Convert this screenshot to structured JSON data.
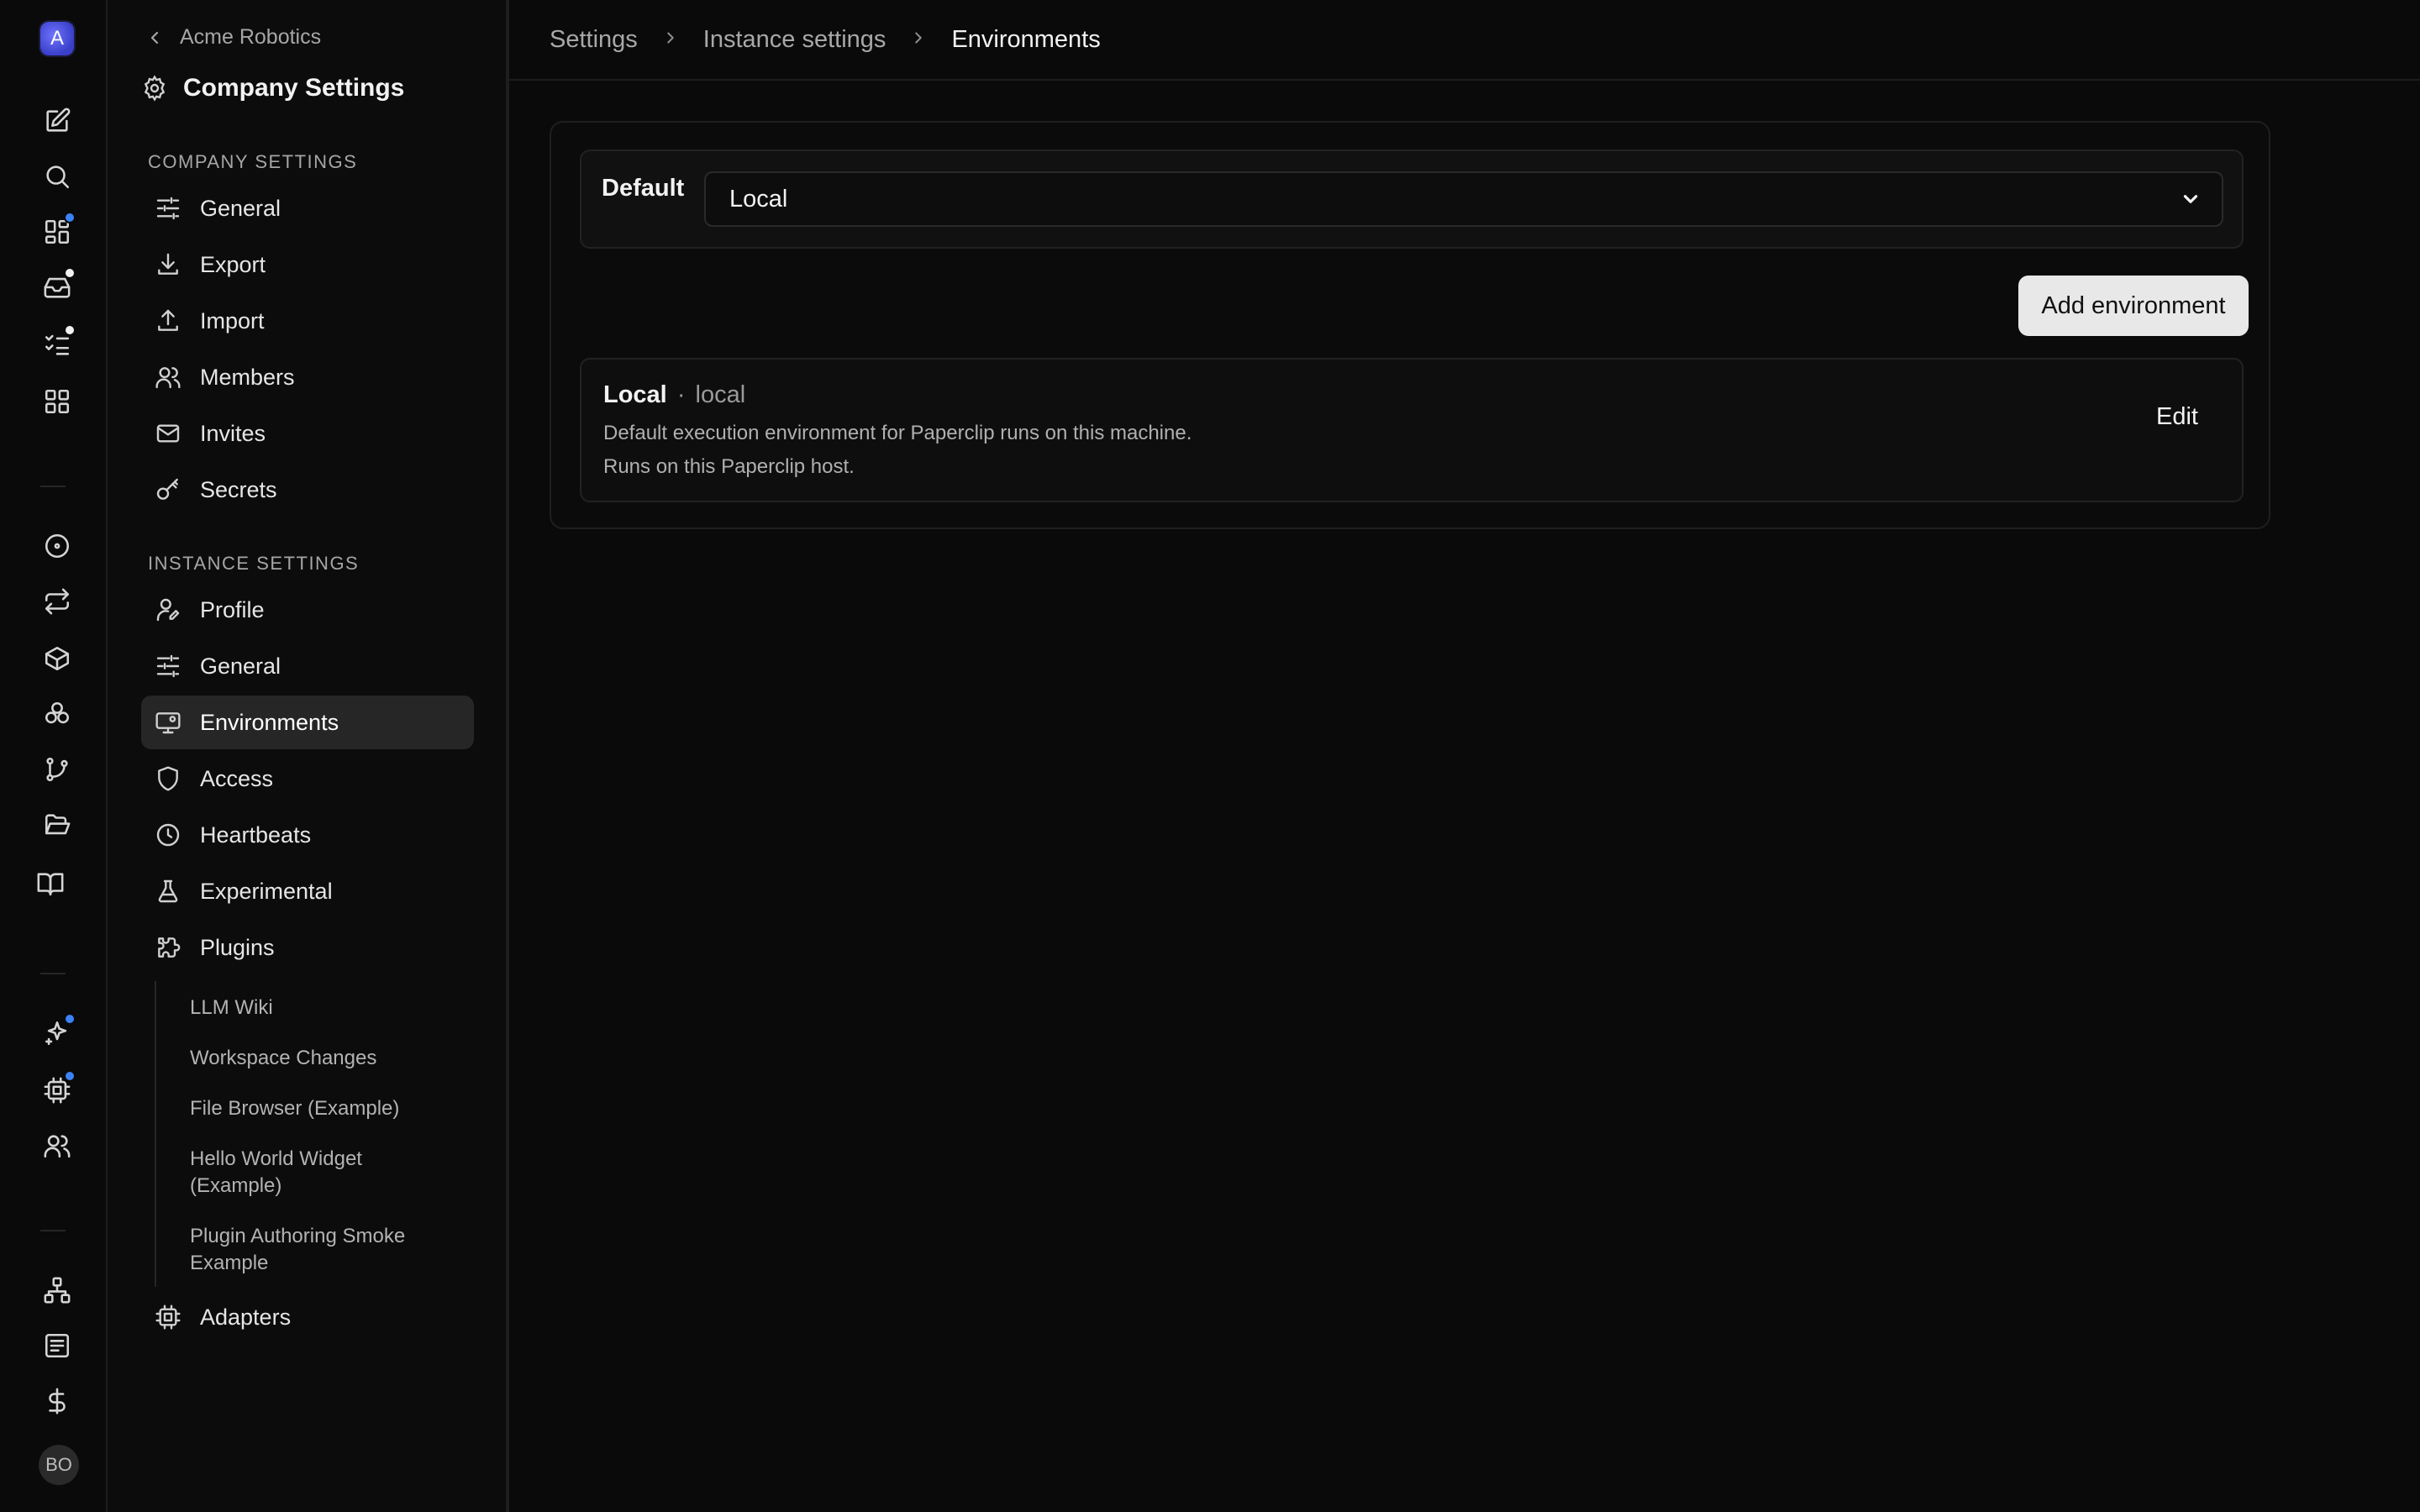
{
  "rail": {
    "company_initial": "A",
    "avatar_initials": "BO",
    "colors": {
      "blue_dot": "#3b82f6",
      "white_dot": "#f0f0f0"
    }
  },
  "sidebar": {
    "back_label": "Acme Robotics",
    "title": "Company Settings",
    "company_section_label": "COMPANY SETTINGS",
    "company_items": [
      {
        "label": "General",
        "icon": "sliders-icon"
      },
      {
        "label": "Export",
        "icon": "download-icon"
      },
      {
        "label": "Import",
        "icon": "upload-icon"
      },
      {
        "label": "Members",
        "icon": "users-icon"
      },
      {
        "label": "Invites",
        "icon": "mail-icon"
      },
      {
        "label": "Secrets",
        "icon": "key-icon"
      }
    ],
    "instance_section_label": "INSTANCE SETTINGS",
    "instance_items": [
      {
        "label": "Profile",
        "icon": "user-pen-icon"
      },
      {
        "label": "General",
        "icon": "sliders-icon"
      },
      {
        "label": "Environments",
        "icon": "monitor-cog-icon",
        "active": true
      },
      {
        "label": "Access",
        "icon": "shield-icon"
      },
      {
        "label": "Heartbeats",
        "icon": "clock-icon"
      },
      {
        "label": "Experimental",
        "icon": "flask-icon"
      },
      {
        "label": "Plugins",
        "icon": "puzzle-icon"
      }
    ],
    "plugins": [
      "LLM Wiki",
      "Workspace Changes",
      "File Browser (Example)",
      "Hello World Widget (Example)",
      "Plugin Authoring Smoke Example"
    ],
    "adapters_label": "Adapters"
  },
  "breadcrumb": {
    "items": [
      "Settings",
      "Instance settings",
      "Environments"
    ]
  },
  "environments": {
    "default_label": "Default",
    "default_value": "Local",
    "add_button_label": "Add environment",
    "list": [
      {
        "name": "Local",
        "separator": "·",
        "slug": "local",
        "description": "Default execution environment for Paperclip runs on this machine.",
        "host_note": "Runs on this Paperclip host.",
        "edit_label": "Edit"
      }
    ]
  }
}
